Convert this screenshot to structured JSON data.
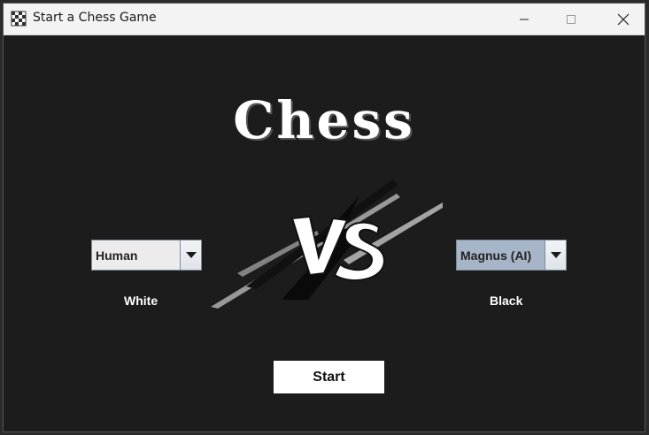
{
  "window": {
    "title": "Start a Chess Game",
    "icons": {
      "app": "chess-board-icon",
      "minimize": "minimize-icon",
      "maximize": "maximize-icon",
      "close": "close-icon"
    }
  },
  "main": {
    "heading": "Chess",
    "vs_graphic": "vs-icon",
    "white_player": {
      "selected": "Human",
      "label": "White"
    },
    "black_player": {
      "selected": "Magnus (AI)",
      "label": "Black"
    },
    "start_label": "Start"
  }
}
